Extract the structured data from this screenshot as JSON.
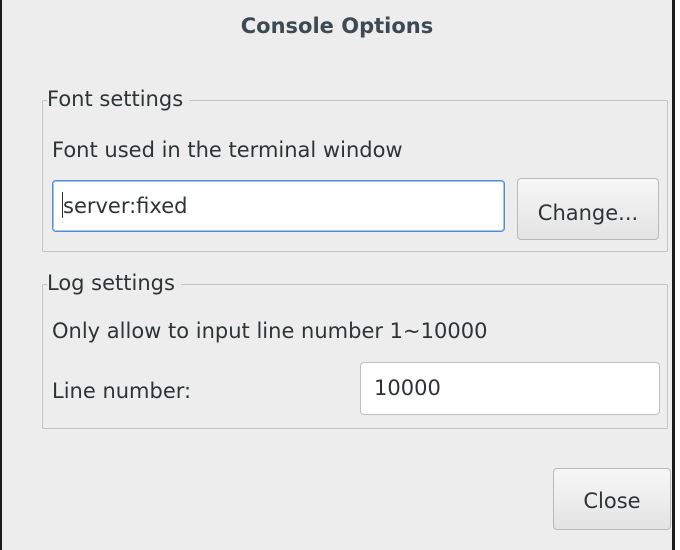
{
  "window": {
    "title": "Console Options"
  },
  "font_settings": {
    "legend": "Font settings",
    "description": "Font used in the terminal window",
    "font_value": "server:fixed",
    "change_button_label": "Change..."
  },
  "log_settings": {
    "legend": "Log settings",
    "description": "Only allow to input line number 1~10000",
    "line_number_label": "Line number:",
    "line_number_value": "10000"
  },
  "actions": {
    "close_label": "Close"
  },
  "colors": {
    "focus_border": "#4a90d9",
    "dialog_background": "#ededed",
    "text": "#2e3436"
  }
}
